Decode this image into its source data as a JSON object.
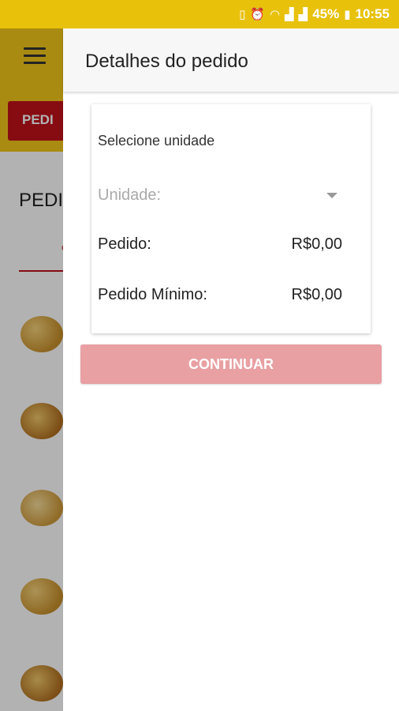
{
  "status_bar": {
    "battery_percent": "45%",
    "time": "10:55",
    "icons": [
      "vibrate-icon",
      "alarm-icon",
      "wifi-icon",
      "signal-1-icon",
      "signal-2-icon",
      "battery-charging-icon"
    ]
  },
  "background": {
    "tab_button_label": "PEDI",
    "heading_text": "PEDI",
    "tab_partial": "c"
  },
  "drawer": {
    "title": "Detalhes do pedido",
    "select_label": "Selecione unidade",
    "unidade_placeholder": "Unidade:",
    "pedido_label": "Pedido:",
    "pedido_value": "R$0,00",
    "minimo_label": "Pedido Mínimo:",
    "minimo_value": "R$0,00",
    "continue_label": "CONTINUAR"
  },
  "colors": {
    "toolbar": "#f2c81a",
    "accent_red": "#c0121a",
    "button_disabled": "#e8a0a3"
  }
}
